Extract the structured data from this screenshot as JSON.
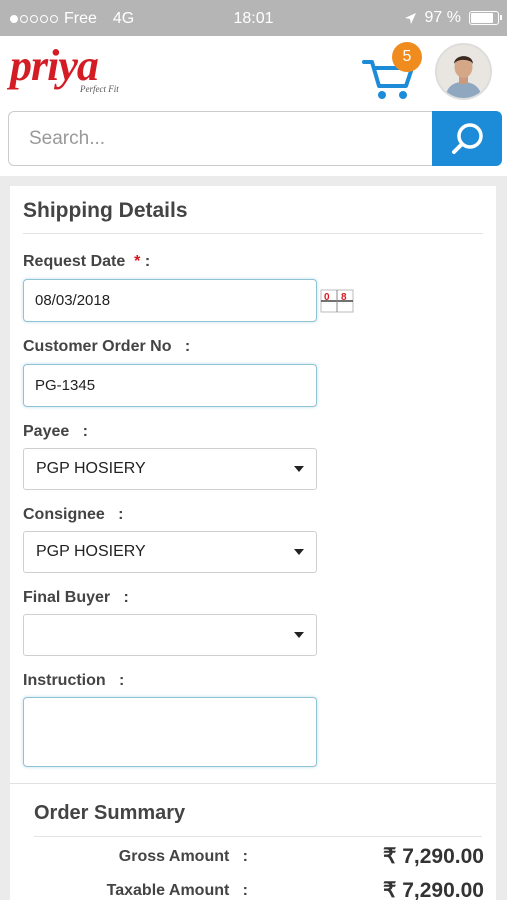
{
  "status_bar": {
    "carrier": "Free",
    "network": "4G",
    "time": "18:01",
    "battery": "97 %",
    "signal_level": 1
  },
  "header": {
    "logo_text": "priya",
    "logo_tagline": "Perfect Fit",
    "cart_count": "5",
    "accent": "#1d8cd8",
    "brand": "#d41c24"
  },
  "search": {
    "placeholder": "Search...",
    "value": ""
  },
  "shipping": {
    "title": "Shipping Details",
    "request_date": {
      "label": "Request Date",
      "required": "*",
      "sep": ":",
      "value": "08/03/2018",
      "icon": "calendar-icon"
    },
    "customer_order_no": {
      "label": "Customer Order No",
      "sep": ":",
      "value": "PG-1345"
    },
    "payee": {
      "label": "Payee",
      "sep": ":",
      "value": "PGP HOSIERY"
    },
    "consignee": {
      "label": "Consignee",
      "sep": ":",
      "value": "PGP HOSIERY"
    },
    "final_buyer": {
      "label": "Final Buyer",
      "sep": ":",
      "value": ""
    },
    "instruction": {
      "label": "Instruction",
      "sep": ":",
      "value": ""
    }
  },
  "summary": {
    "title": "Order Summary",
    "rows": [
      {
        "label": "Gross Amount",
        "sep": ":",
        "value": "₹ 7,290.00"
      },
      {
        "label": "Taxable Amount",
        "sep": ":",
        "value": "₹ 7,290.00"
      }
    ]
  }
}
